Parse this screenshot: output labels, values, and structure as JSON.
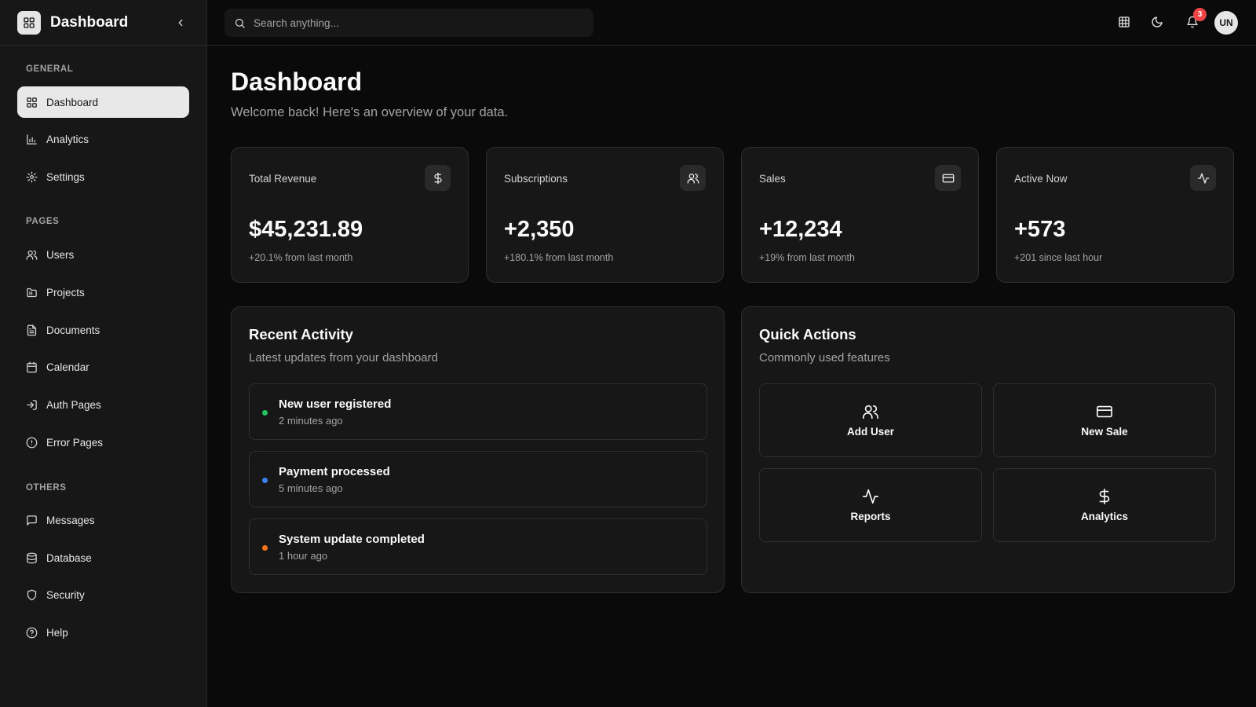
{
  "app": {
    "title": "Dashboard"
  },
  "sidebar": {
    "sections": [
      {
        "label": "GENERAL",
        "items": [
          {
            "label": "Dashboard",
            "icon": "dashboard-icon",
            "active": true
          },
          {
            "label": "Analytics",
            "icon": "bar-chart-icon"
          },
          {
            "label": "Settings",
            "icon": "gear-icon"
          }
        ]
      },
      {
        "label": "PAGES",
        "items": [
          {
            "label": "Users",
            "icon": "users-icon"
          },
          {
            "label": "Projects",
            "icon": "folder-icon"
          },
          {
            "label": "Documents",
            "icon": "document-icon"
          },
          {
            "label": "Calendar",
            "icon": "calendar-icon"
          },
          {
            "label": "Auth Pages",
            "icon": "login-icon"
          },
          {
            "label": "Error Pages",
            "icon": "alert-circle-icon"
          }
        ]
      },
      {
        "label": "OTHERS",
        "items": [
          {
            "label": "Messages",
            "icon": "message-icon"
          },
          {
            "label": "Database",
            "icon": "database-icon"
          },
          {
            "label": "Security",
            "icon": "shield-icon"
          },
          {
            "label": "Help",
            "icon": "help-circle-icon"
          }
        ]
      }
    ]
  },
  "topbar": {
    "search_placeholder": "Search anything...",
    "notification_count": "3",
    "avatar_initials": "UN"
  },
  "main": {
    "title": "Dashboard",
    "subtitle": "Welcome back! Here's an overview of your data.",
    "stats": [
      {
        "label": "Total Revenue",
        "value": "$45,231.89",
        "note": "+20.1% from last month",
        "icon": "dollar-icon"
      },
      {
        "label": "Subscriptions",
        "value": "+2,350",
        "note": "+180.1% from last month",
        "icon": "users-icon"
      },
      {
        "label": "Sales",
        "value": "+12,234",
        "note": "+19% from last month",
        "icon": "credit-card-icon"
      },
      {
        "label": "Active Now",
        "value": "+573",
        "note": "+201 since last hour",
        "icon": "activity-icon"
      }
    ],
    "recent_activity": {
      "title": "Recent Activity",
      "subtitle": "Latest updates from your dashboard",
      "items": [
        {
          "title": "New user registered",
          "time": "2 minutes ago",
          "color": "#22c55e"
        },
        {
          "title": "Payment processed",
          "time": "5 minutes ago",
          "color": "#3b82f6"
        },
        {
          "title": "System update completed",
          "time": "1 hour ago",
          "color": "#f97316"
        }
      ]
    },
    "quick_actions": {
      "title": "Quick Actions",
      "subtitle": "Commonly used features",
      "items": [
        {
          "label": "Add User",
          "icon": "users-icon"
        },
        {
          "label": "New Sale",
          "icon": "credit-card-icon"
        },
        {
          "label": "Reports",
          "icon": "activity-icon"
        },
        {
          "label": "Analytics",
          "icon": "dollar-icon"
        }
      ]
    }
  }
}
